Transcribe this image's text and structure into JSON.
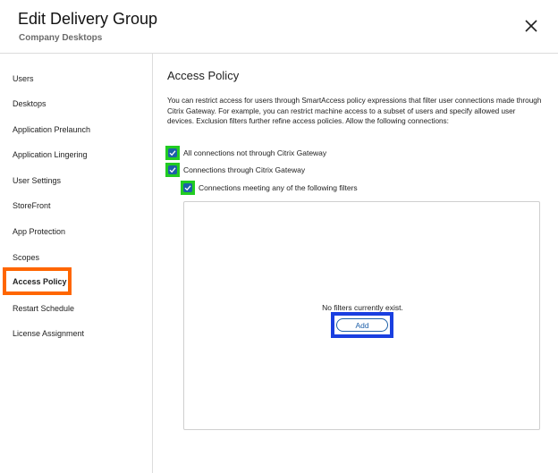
{
  "header": {
    "title": "Edit Delivery Group",
    "subtitle": "Company Desktops"
  },
  "sidebar": {
    "items": [
      {
        "label": "Users"
      },
      {
        "label": "Desktops"
      },
      {
        "label": "Application Prelaunch"
      },
      {
        "label": "Application Lingering"
      },
      {
        "label": "User Settings"
      },
      {
        "label": "StoreFront"
      },
      {
        "label": "App Protection"
      },
      {
        "label": "Scopes"
      },
      {
        "label": "Access Policy",
        "active": true
      },
      {
        "label": "Restart Schedule"
      },
      {
        "label": "License Assignment"
      }
    ]
  },
  "main": {
    "section_title": "Access Policy",
    "description": "You can restrict access for users through SmartAccess policy expressions that filter user connections made through Citrix Gateway. For example, you can restrict machine access to a subset of users and specify allowed user devices. Exclusion filters further refine access policies. Allow the following connections:",
    "checkboxes": [
      {
        "label": "All connections not through Citrix Gateway",
        "checked": true
      },
      {
        "label": "Connections through Citrix Gateway",
        "checked": true
      },
      {
        "label": "Connections meeting any of the following filters",
        "checked": true
      }
    ],
    "filters": {
      "empty_message": "No filters currently exist.",
      "add_label": "Add"
    }
  },
  "colors": {
    "highlight_active_nav": "#ff6600",
    "highlight_checkbox": "#22cc22",
    "highlight_add": "#1a3fe0",
    "accent": "#1d5fa8"
  },
  "icons": {
    "close": "close-icon",
    "check": "check-icon"
  }
}
